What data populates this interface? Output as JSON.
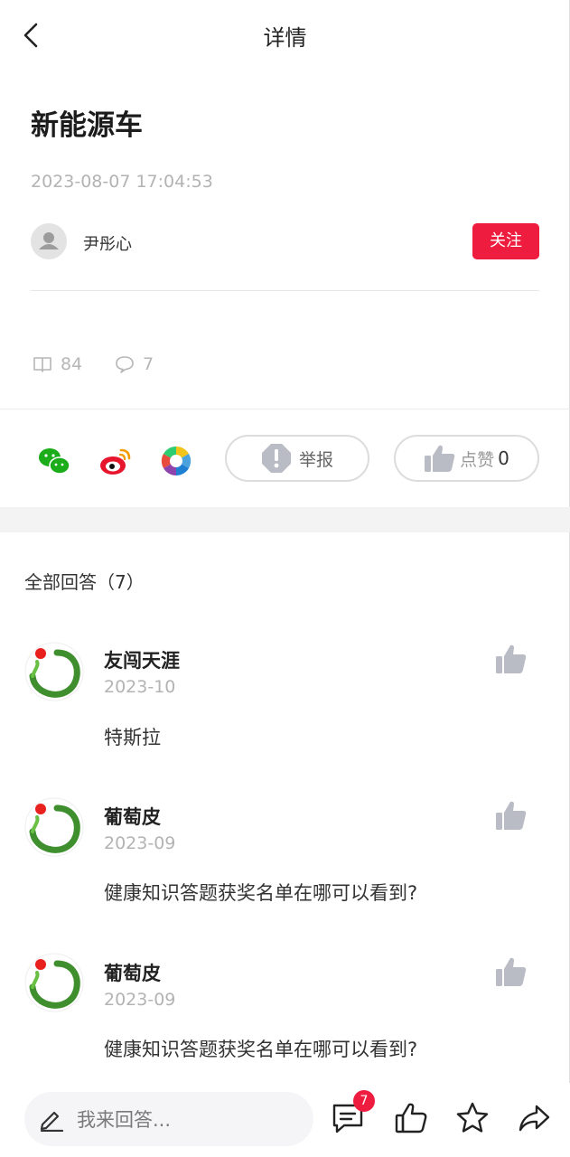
{
  "header": {
    "title": "详情"
  },
  "question": {
    "title": "新能源车",
    "time": "2023-08-07 17:04:53",
    "author": "尹彤心",
    "follow_label": "关注",
    "views": "84",
    "comments": "7"
  },
  "actions": {
    "report_label": "举报",
    "like_label": "点赞",
    "like_count": "0"
  },
  "answers": {
    "header": "全部回答（7）",
    "items": [
      {
        "name": "友闯天涯",
        "date": "2023-10",
        "text": "特斯拉"
      },
      {
        "name": "葡萄皮",
        "date": "2023-09",
        "text": "健康知识答题获奖名单在哪可以看到?"
      },
      {
        "name": "葡萄皮",
        "date": "2023-09",
        "text": "健康知识答题获奖名单在哪可以看到?"
      }
    ]
  },
  "bottom": {
    "reply_placeholder": "我来回答...",
    "comment_badge": "7"
  },
  "colors": {
    "accent": "#ee1d40",
    "muted": "#b3b3b3"
  }
}
